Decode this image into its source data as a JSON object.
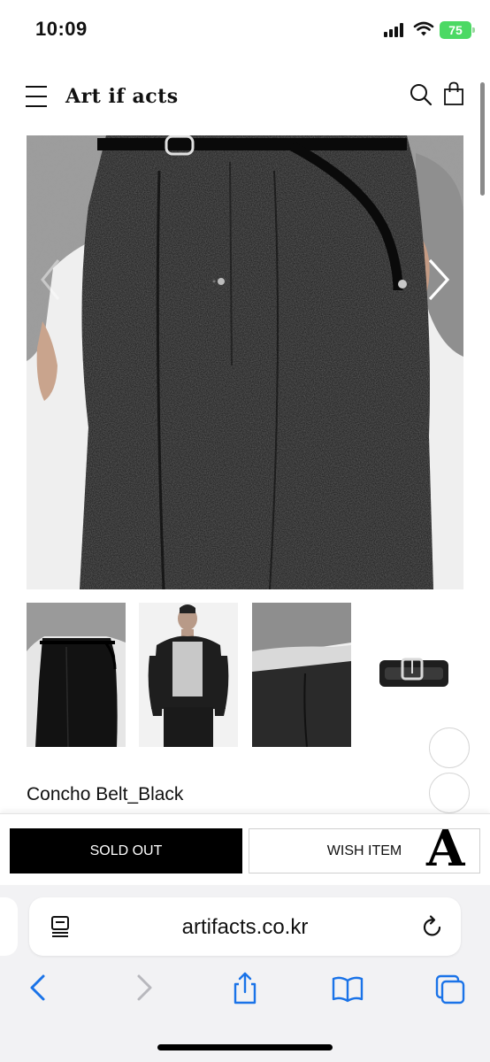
{
  "status_bar": {
    "time": "10:09",
    "battery_level": "75",
    "battery_color": "#4cd964"
  },
  "header": {
    "logo": "Art if acts",
    "menu_icon": "hamburger-menu-icon",
    "search_icon": "search-icon",
    "cart_icon": "shopping-bag-icon"
  },
  "gallery": {
    "thumbnails": [
      "thumbnail-trousers-front",
      "thumbnail-model-jacket",
      "thumbnail-waist-closeup",
      "thumbnail-belt"
    ],
    "prev_icon": "chevron-left-icon",
    "next_icon": "chevron-right-icon"
  },
  "product": {
    "title": "Concho Belt_Black"
  },
  "actions": {
    "sold_out_label": "SOLD OUT",
    "wish_label": "WISH ITEM",
    "brand_mark": "A"
  },
  "browser": {
    "url": "artifacts.co.kr",
    "toolbar_icons": [
      "back-icon",
      "forward-icon",
      "share-icon",
      "bookmarks-icon",
      "tabs-icon"
    ]
  },
  "colors": {
    "primary_button": "#000000",
    "browser_accent": "#1a73e8",
    "browser_bar": "#f2f2f4"
  }
}
